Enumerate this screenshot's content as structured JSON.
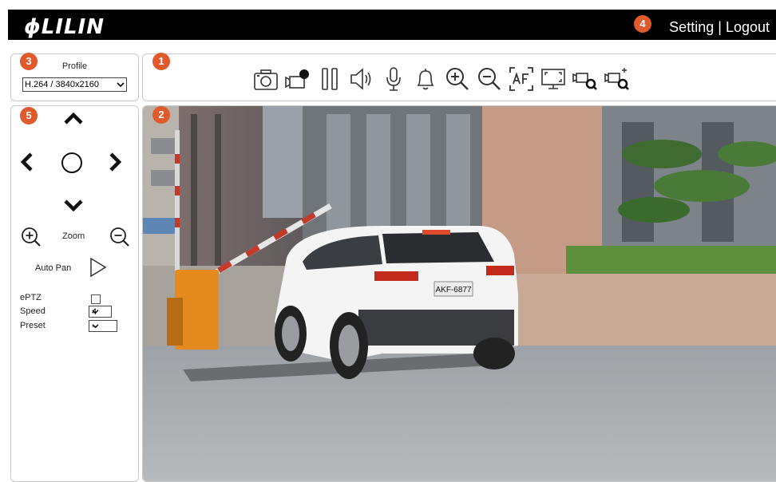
{
  "header": {
    "logo_text": "LILIN",
    "setting_label": "Setting",
    "separator": "|",
    "logout_label": "Logout"
  },
  "badges": {
    "toolbar": "1",
    "video": "2",
    "profile": "3",
    "header": "4",
    "ptz": "5"
  },
  "profile": {
    "label": "Profile",
    "selected": "H.264 / 3840x2160"
  },
  "toolbar": {
    "icons": [
      "snapshot-icon",
      "record-icon",
      "pause-icon",
      "speaker-icon",
      "microphone-icon",
      "alarm-bell-icon",
      "zoom-in-icon",
      "zoom-out-icon",
      "autofocus-icon",
      "fullscreen-icon",
      "digital-zoom-icon",
      "digital-zoom-plus-icon"
    ]
  },
  "ptz": {
    "zoom_label": "Zoom",
    "auto_pan_label": "Auto Pan",
    "eptz_label": "ePTZ",
    "speed_label": "Speed",
    "speed_value": "4",
    "preset_label": "Preset",
    "preset_value": "--"
  },
  "video": {
    "license_plate": "AKF-6877"
  },
  "colors": {
    "header_bg": "#000000",
    "badge": "#e05a2b",
    "border": "#c8c8c8"
  }
}
